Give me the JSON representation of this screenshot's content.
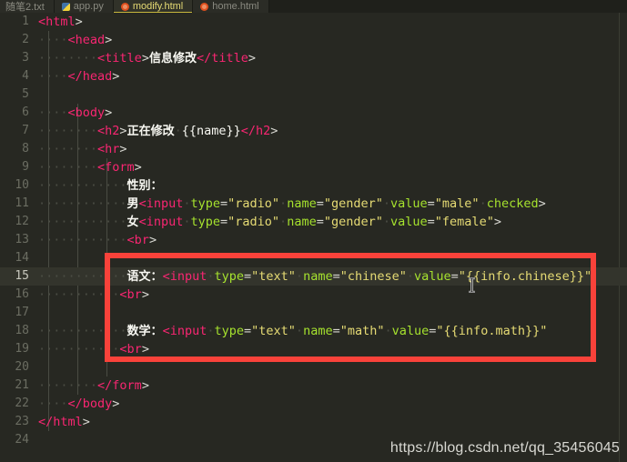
{
  "window": {
    "title": "modify.html",
    "theme_background": "#272822",
    "accent_red": "#f9423a",
    "active_tab_underline": "#c7b63c"
  },
  "tabs": [
    {
      "label": "随笔2.txt",
      "icon": "text-file-icon",
      "active": false
    },
    {
      "label": "app.py",
      "icon": "python-file-icon",
      "active": false
    },
    {
      "label": "modify.html",
      "icon": "html-file-icon",
      "active": true
    },
    {
      "label": "home.html",
      "icon": "html-file-icon",
      "active": false
    }
  ],
  "editor": {
    "current_line": 15,
    "line_numbers": [
      1,
      2,
      3,
      4,
      5,
      6,
      7,
      8,
      9,
      10,
      11,
      12,
      13,
      14,
      15,
      16,
      17,
      18,
      19,
      20,
      21,
      22,
      23,
      24
    ],
    "lines": [
      {
        "n": 1,
        "raw": "<html>"
      },
      {
        "n": 2,
        "raw": "    <head>"
      },
      {
        "n": 3,
        "raw": "        <title>信息修改</title>"
      },
      {
        "n": 4,
        "raw": "    </head>"
      },
      {
        "n": 5,
        "raw": ""
      },
      {
        "n": 6,
        "raw": "    <body>"
      },
      {
        "n": 7,
        "raw": "        <h2>正在修改 {{name}}</h2>"
      },
      {
        "n": 8,
        "raw": "        <hr>"
      },
      {
        "n": 9,
        "raw": "        <form>"
      },
      {
        "n": 10,
        "raw": "            性别："
      },
      {
        "n": 11,
        "raw": "            男<input type=\"radio\" name=\"gender\" value=\"male\" checked>"
      },
      {
        "n": 12,
        "raw": "            女<input type=\"radio\" name=\"gender\" value=\"female\">"
      },
      {
        "n": 13,
        "raw": "            <br>"
      },
      {
        "n": 14,
        "raw": ""
      },
      {
        "n": 15,
        "raw": "            语文：<input type=\"text\" name=\"chinese\" value=\"{{info.chinese}}\""
      },
      {
        "n": 16,
        "raw": "            <br>"
      },
      {
        "n": 17,
        "raw": ""
      },
      {
        "n": 18,
        "raw": "            数学：<input type=\"text\" name=\"math\" value=\"{{info.math}}\""
      },
      {
        "n": 19,
        "raw": "            <br>"
      },
      {
        "n": 20,
        "raw": ""
      },
      {
        "n": 21,
        "raw": "        </form>"
      },
      {
        "n": 22,
        "raw": "    </body>"
      },
      {
        "n": 23,
        "raw": "</html>"
      },
      {
        "n": 24,
        "raw": ""
      }
    ]
  },
  "annotation": {
    "type": "red-rectangle",
    "color": "#f9423a",
    "covers_lines": "15-19"
  },
  "watermark": {
    "text": "https://blog.csdn.net/qq_35456045"
  }
}
